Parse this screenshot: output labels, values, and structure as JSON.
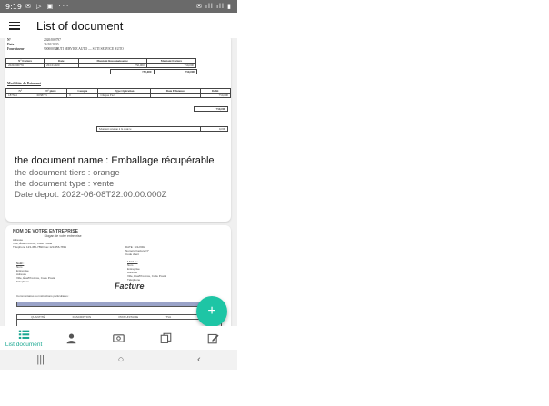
{
  "status_bar": {
    "time": "9:19",
    "left_icons": "✉ ▷ ▣ ···",
    "right_icons": "✉ ıll ıll ▮"
  },
  "app_bar": {
    "title": "List of document"
  },
  "cards": [
    {
      "doc_preview": {
        "info_no_label": "N°",
        "info_no": "2020/000797",
        "info_date_label": "Date",
        "info_date": "26/10/2020",
        "info_supplier_label": "Fournisseur",
        "info_supplier": "900000320",
        "vendor": "SUTI SERVICE AUTO — SUTI SERVICE AUTO",
        "table_headers": [
          "N° Facture",
          "Date",
          "Montant Reconnaissance",
          "Montant Facture"
        ],
        "table_row": [
          "2020/000776",
          "26/10/2020",
          "750,000",
          "750,000"
        ],
        "table_sum": [
          "750,000",
          "750,000"
        ],
        "modalities_title": "Modalités de Paiement",
        "pay_headers": [
          "N°",
          "N° pièce",
          "Compte",
          "Type Opération",
          "Date Echéance",
          "Débit"
        ],
        "pay_row": [
          "187364",
          "0038715",
          "0",
          "Chèque Fact",
          "",
          "750,000"
        ],
        "pay_total": "750,000",
        "return_label": "Montant retenue à la source",
        "return_value": "0,000"
      },
      "name": "the document name : Emballage récupérable",
      "tiers": "the document tiers : orange",
      "type": "the document type : vente",
      "date_depot": "Date depot: 2022-06-08T22:00:00.000Z"
    },
    {
      "invoice_preview": {
        "company": "NOM DE VOTRE ENTREPRISE",
        "slogan": "Slogan de votre entreprise",
        "address": "Adresse",
        "city": "Ville, État/Province, Code Postal",
        "phone": "Téléphone 123-456-7890   Fax 123-456-7891",
        "date_line": "DATE : 1/1/2002",
        "invoice_no": "Numéro Facture N°",
        "client_code": "Code client",
        "bill_to": "Sold :",
        "ship_to": "Livré à :",
        "bill_lines": [
          "Nom",
          "Entreprise",
          "Adresse",
          "Ville, État/Province, Code Postal",
          "Téléphone"
        ],
        "ship_lines": [
          "Nom",
          "Entreprise",
          "Adresse",
          "Ville, État/Province, Code Postal",
          "Téléphone"
        ],
        "comments": "Commentaires ou instructions particulières :",
        "facture": "Facture",
        "cols": [
          "QUANTITÉ",
          "DESCRIPTION",
          "PRIX UNITAIRE",
          "TVA",
          "TOTAL"
        ]
      }
    }
  ],
  "fab": {
    "symbol": "+"
  },
  "bottom_nav": {
    "items": [
      {
        "label": "List document",
        "icon": "list-icon",
        "active": true
      },
      {
        "label": "",
        "icon": "person-icon"
      },
      {
        "label": "",
        "icon": "money-icon"
      },
      {
        "label": "",
        "icon": "documents-icon"
      },
      {
        "label": "",
        "icon": "edit-icon"
      }
    ]
  },
  "system_nav": {
    "recent": "|||",
    "home": "○",
    "back": "‹"
  },
  "colors": {
    "accent": "#1ec5a5",
    "active_nav": "#1aa891",
    "status_bar": "#6a6a6a"
  }
}
